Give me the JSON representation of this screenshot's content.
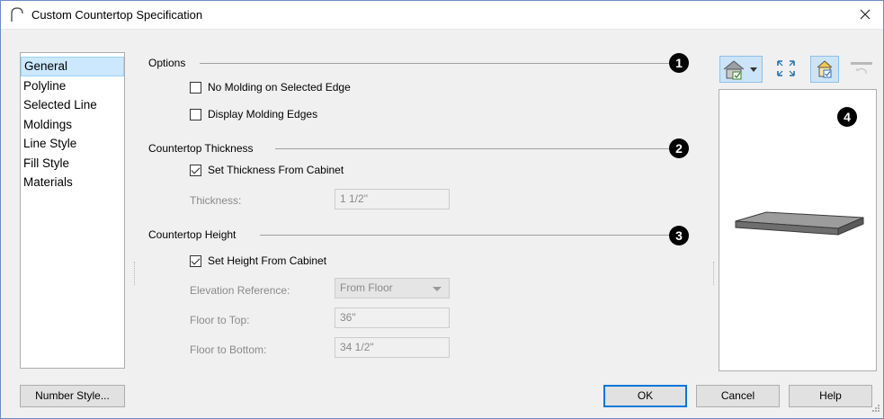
{
  "window": {
    "title": "Custom Countertop Specification"
  },
  "sidebar": {
    "items": [
      {
        "label": "General",
        "selected": true
      },
      {
        "label": "Polyline"
      },
      {
        "label": "Selected Line"
      },
      {
        "label": "Moldings"
      },
      {
        "label": "Line Style"
      },
      {
        "label": "Fill Style"
      },
      {
        "label": "Materials"
      }
    ]
  },
  "options": {
    "heading": "Options",
    "callout": "1",
    "no_molding": {
      "label": "No Molding on Selected Edge",
      "checked": false
    },
    "display_edges": {
      "label": "Display Molding Edges",
      "checked": false
    }
  },
  "thickness": {
    "heading": "Countertop Thickness",
    "callout": "2",
    "from_cabinet": {
      "label": "Set Thickness From Cabinet",
      "checked": true
    },
    "thickness_label": "Thickness:",
    "thickness_value": "1 1/2\""
  },
  "height": {
    "heading": "Countertop Height",
    "callout": "3",
    "from_cabinet": {
      "label": "Set Height From Cabinet",
      "checked": true
    },
    "elevation_label": "Elevation Reference:",
    "elevation_value": "From Floor",
    "floor_top_label": "Floor to Top:",
    "floor_top_value": "36\"",
    "floor_bottom_label": "Floor to Bottom:",
    "floor_bottom_value": "34 1/2\""
  },
  "preview": {
    "callout": "4"
  },
  "buttons": {
    "number_style": "Number Style...",
    "ok": "OK",
    "cancel": "Cancel",
    "help": "Help"
  },
  "icons": {
    "app": "arch-icon",
    "close": "close-icon",
    "view": "house-view-icon",
    "fit": "fit-to-window-icon",
    "material": "material-preview-icon",
    "refresh": "refresh-icon"
  }
}
